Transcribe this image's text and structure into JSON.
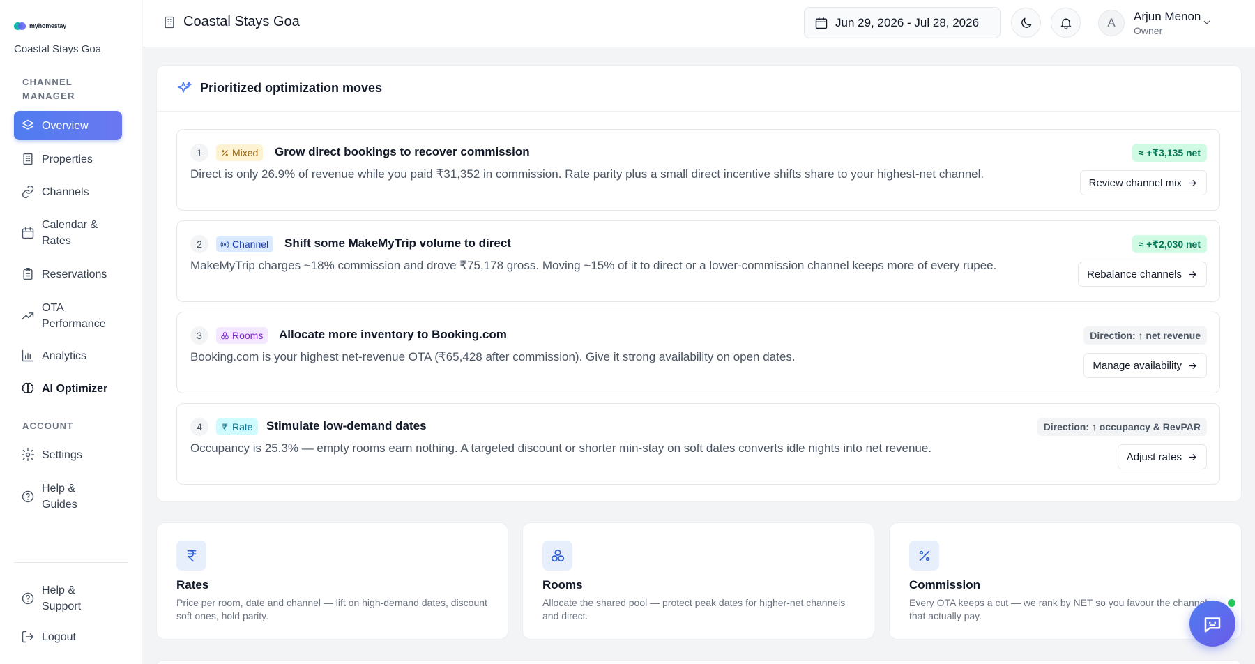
{
  "brand": {
    "logo_text": "myhomestay",
    "property_name": "Coastal Stays Goa"
  },
  "sidebar": {
    "section_channel": "CHANNEL MANAGER",
    "section_account": "ACCOUNT",
    "items": [
      {
        "label": "Overview",
        "icon": "layers-icon"
      },
      {
        "label": "Properties",
        "icon": "building-icon"
      },
      {
        "label": "Channels",
        "icon": "link-icon"
      },
      {
        "label": "Calendar & Rates",
        "icon": "calendar-icon"
      },
      {
        "label": "Reservations",
        "icon": "clipboard-icon"
      },
      {
        "label": "OTA Performance",
        "icon": "trending-up-icon"
      },
      {
        "label": "Analytics",
        "icon": "bar-chart-icon"
      },
      {
        "label": "AI Optimizer",
        "icon": "brain-icon"
      }
    ],
    "account_items": [
      {
        "label": "Settings",
        "icon": "gear-icon"
      },
      {
        "label": "Help & Guides",
        "icon": "help-circle-icon"
      }
    ],
    "footer_items": [
      {
        "label": "Help & Support",
        "icon": "help-circle-icon"
      },
      {
        "label": "Logout",
        "icon": "logout-icon"
      }
    ]
  },
  "header": {
    "title": "Coastal Stays Goa",
    "date_range": "Jun 29, 2026 - Jul 28, 2026",
    "user": {
      "initial": "A",
      "name": "Arjun Menon",
      "role": "Owner"
    }
  },
  "optimizer": {
    "title": "Prioritized optimization moves",
    "moves": [
      {
        "number": "1",
        "tag": "Mixed",
        "title": "Grow direct bookings to recover commission",
        "description": "Direct is only 26.9% of revenue while you paid ₹31,352 in commission. Rate parity plus a small direct incentive shifts share to your highest-net channel.",
        "impact": "≈ +₹3,135 net",
        "action": "Review channel mix"
      },
      {
        "number": "2",
        "tag": "Channel",
        "title": "Shift some MakeMyTrip volume to direct",
        "description": "MakeMyTrip charges ~18% commission and drove ₹75,178 gross. Moving ~15% of it to direct or a lower-commission channel keeps more of every rupee.",
        "impact": "≈ +₹2,030 net",
        "action": "Rebalance channels"
      },
      {
        "number": "3",
        "tag": "Rooms",
        "title": "Allocate more inventory to Booking.com",
        "description": "Booking.com is your highest net-revenue OTA (₹65,428 after commission). Give it strong availability on open dates.",
        "impact": "Direction: ↑ net revenue",
        "action": "Manage availability"
      },
      {
        "number": "4",
        "tag": "Rate",
        "title": "Stimulate low-demand dates",
        "description": "Occupancy is 25.3% — empty rooms earn nothing. A targeted discount or shorter min-stay on soft dates converts idle nights into net revenue.",
        "impact": "Direction: ↑ occupancy & RevPAR",
        "action": "Adjust rates"
      }
    ]
  },
  "levers": [
    {
      "title": "Rates",
      "icon": "rupee-icon",
      "description": "Price per room, date and channel — lift on high-demand dates, discount soft ones, hold parity."
    },
    {
      "title": "Rooms",
      "icon": "boxes-icon",
      "description": "Allocate the shared pool — protect peak dates for higher-net channels and direct."
    },
    {
      "title": "Commission",
      "icon": "percent-icon",
      "description": "Every OTA keeps a cut — we rank by NET so you favour the channels that actually pay."
    }
  ],
  "colors": {
    "accent": "#4f7cf0",
    "positive": "#047857",
    "positive_bg": "#d1fae5"
  }
}
